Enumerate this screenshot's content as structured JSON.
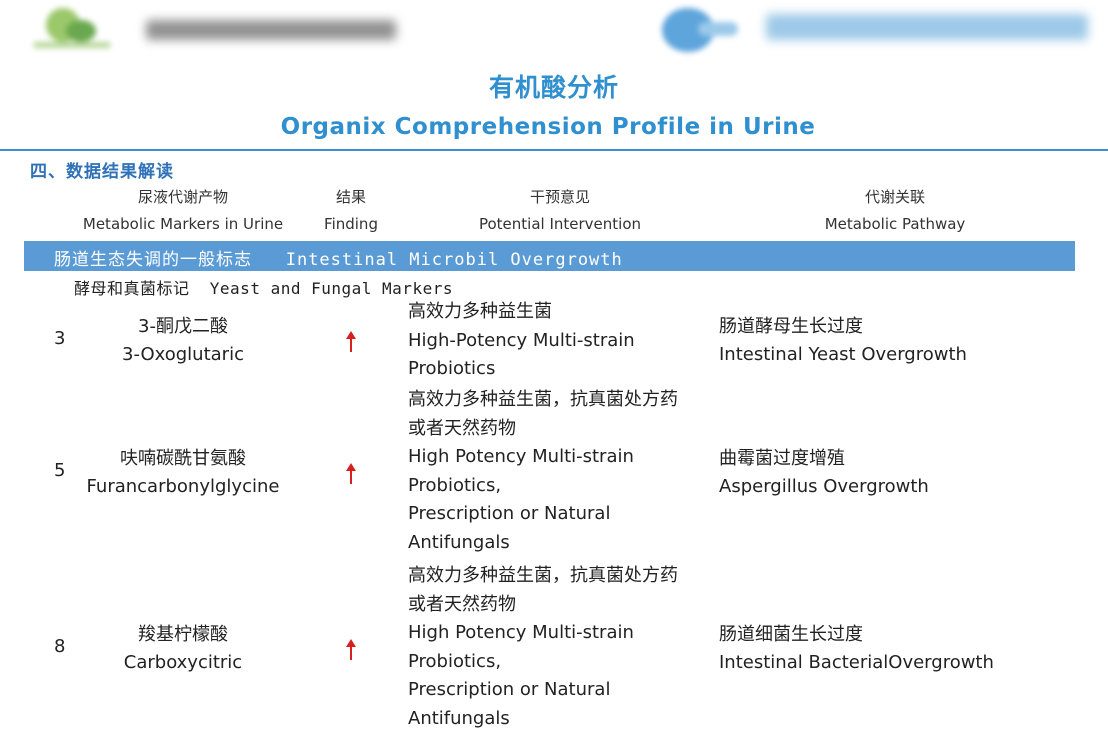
{
  "header": {
    "title_cn": "有机酸分析",
    "title_en": "Organix Comprehension Profile in Urine"
  },
  "section_title": "四、数据结果解读",
  "columns": [
    {
      "cn": "尿液代谢产物",
      "en": "Metabolic Markers in Urine"
    },
    {
      "cn": "结果",
      "en": "Finding"
    },
    {
      "cn": "干预意见",
      "en": "Potential Intervention"
    },
    {
      "cn": "代谢关联",
      "en": "Metabolic Pathway"
    }
  ],
  "band": {
    "cn": "肠道生态失调的一般标志",
    "en": "Intestinal Microbil Overgrowth"
  },
  "subheading": {
    "cn": "酵母和真菌标记",
    "en": "Yeast and Fungal Markers"
  },
  "rows": [
    {
      "number": "3",
      "marker_cn": "3-酮戊二酸",
      "marker_en": "3-Oxoglutaric",
      "finding": "up-arrow",
      "intervention": [
        "高效力多种益生菌",
        "High-Potency Multi-strain",
        "Probiotics"
      ],
      "pathway_cn": "肠道酵母生长过度",
      "pathway_en": "Intestinal Yeast Overgrowth"
    },
    {
      "number": "5",
      "marker_cn": "呋喃碳酰甘氨酸",
      "marker_en": "Furancarbonylglycine",
      "finding": "up-arrow",
      "intervention": [
        "高效力多种益生菌，抗真菌处方药",
        "或者天然药物",
        "High Potency Multi-strain",
        "Probiotics,",
        "Prescription or Natural",
        "Antifungals"
      ],
      "pathway_cn": "曲霉菌过度增殖",
      "pathway_en": "Aspergillus Overgrowth"
    },
    {
      "number": "8",
      "marker_cn": "羧基柠檬酸",
      "marker_en": "Carboxycitric",
      "finding": "up-arrow",
      "intervention": [
        "高效力多种益生菌，抗真菌处方药",
        "或者天然药物",
        "High Potency Multi-strain",
        "Probiotics,",
        "Prescription or Natural",
        "Antifungals"
      ],
      "pathway_cn": "肠道细菌生长过度",
      "pathway_en": "Intestinal BacterialOvergrowth"
    }
  ],
  "colors": {
    "accent": "#2f8fcf",
    "band": "#5b9bd5",
    "arrow": "#d61f1f"
  }
}
